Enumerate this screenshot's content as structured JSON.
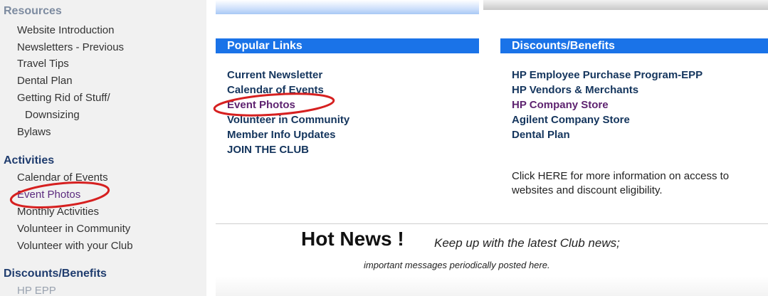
{
  "sidebar": {
    "resources_heading": "Resources",
    "resources_items": [
      "Website Introduction",
      "Newsletters - Previous",
      "Travel Tips",
      "Dental Plan",
      "Getting Rid of Stuff/",
      "Downsizing",
      "Bylaws"
    ],
    "activities_heading": "Activities",
    "activities_items": [
      "Calendar of Events",
      "Event Photos",
      "Monthly Activities",
      "Volunteer in Community",
      "Volunteer with your Club"
    ],
    "discounts_heading": "Discounts/Benefits",
    "discounts_items": [
      "HP EPP"
    ]
  },
  "popular_links": {
    "title": "Popular Links",
    "items": [
      "Current Newsletter",
      "Calendar of Events",
      "Event Photos",
      "Volunteer in Community",
      "Member Info Updates",
      "JOIN THE CLUB"
    ]
  },
  "discounts": {
    "title": "Discounts/Benefits",
    "items": [
      "HP Employee Purchase Program-EPP",
      "HP Vendors & Merchants",
      "HP Company Store",
      "Agilent Company Store",
      "Dental Plan"
    ],
    "info_prefix": "Click ",
    "info_link": "HERE",
    "info_suffix": " for more information on access to websites and discount eligibility."
  },
  "hot_news": {
    "title": "Hot News !",
    "subtitle": "Keep up with the latest Club news;",
    "line2": "important messages periodically posted here."
  },
  "colors": {
    "header_bar": "#1a73e8",
    "annotation_circle": "#d62020",
    "visited_link": "#5e2370"
  }
}
